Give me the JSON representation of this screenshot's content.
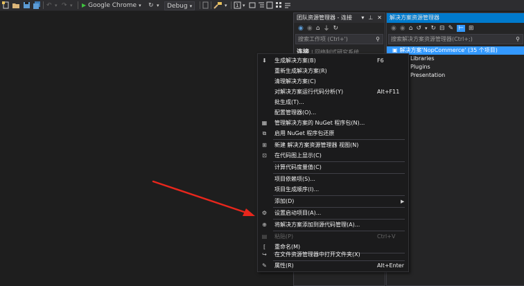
{
  "toolbar": {
    "browser_label": "Google Chrome",
    "config_label": "Debug"
  },
  "team_explorer": {
    "title": "团队资源管理器 - 连接",
    "search_placeholder": "搜索工作项 (Ctrl+')",
    "connect_label": "连接",
    "connect_sub": "| 回络制式研究系统"
  },
  "solution_explorer": {
    "title": "解决方案资源管理器",
    "search_placeholder": "搜索解决方案资源管理器(Ctrl+;)",
    "items": [
      "解决方案'NopCommerce' (35 个项目)",
      "Libraries",
      "Plugins",
      "Presentation"
    ]
  },
  "context_menu": {
    "items": [
      {
        "icon": "build-icon",
        "label": "生成解决方案(B)",
        "shortcut": "F6"
      },
      {
        "label": "重新生成解决方案(R)",
        "shortcut": ""
      },
      {
        "label": "清理解决方案(C)",
        "shortcut": ""
      },
      {
        "label": "对解决方案运行代码分析(Y)",
        "shortcut": "Alt+F11"
      },
      {
        "label": "批生成(T)...",
        "shortcut": ""
      },
      {
        "label": "配置管理器(O)...",
        "shortcut": ""
      },
      {
        "icon": "nuget-icon",
        "label": "管理解决方案的 NuGet 程序包(N)...",
        "shortcut": ""
      },
      {
        "icon": "nuget-restore-icon",
        "label": "启用 NuGet 程序包还原",
        "shortcut": ""
      },
      {
        "icon": "new-view-icon",
        "label": "新建 解决方案资源管理器 视图(N)",
        "shortcut": ""
      },
      {
        "icon": "code-map-icon",
        "label": "在代码图上显示(C)",
        "shortcut": ""
      },
      {
        "label": "计算代码度量值(C)",
        "shortcut": ""
      },
      {
        "label": "项目依赖项(S)...",
        "shortcut": ""
      },
      {
        "label": "项目生成顺序(I)...",
        "shortcut": ""
      },
      {
        "label": "添加(D)",
        "shortcut": ""
      },
      {
        "icon": "gear-icon",
        "label": "设置启动项目(A)...",
        "shortcut": ""
      },
      {
        "icon": "source-control-icon",
        "label": "将解决方案添加到源代码管理(A)...",
        "shortcut": ""
      },
      {
        "icon": "paste-icon",
        "label": "粘贴(P)",
        "shortcut": "Ctrl+V"
      },
      {
        "icon": "rename-icon",
        "label": "重命名(M)",
        "shortcut": ""
      },
      {
        "icon": "open-folder-icon",
        "label": "在文件资源管理器中打开文件夹(X)",
        "shortcut": ""
      },
      {
        "icon": "wrench-icon",
        "label": "属性(R)",
        "shortcut": "Alt+Enter"
      }
    ]
  },
  "colors": {
    "accent": "#007acc",
    "arrow": "#e8261c",
    "background": "#1e1e1e",
    "menu": "#1b1b1c"
  }
}
